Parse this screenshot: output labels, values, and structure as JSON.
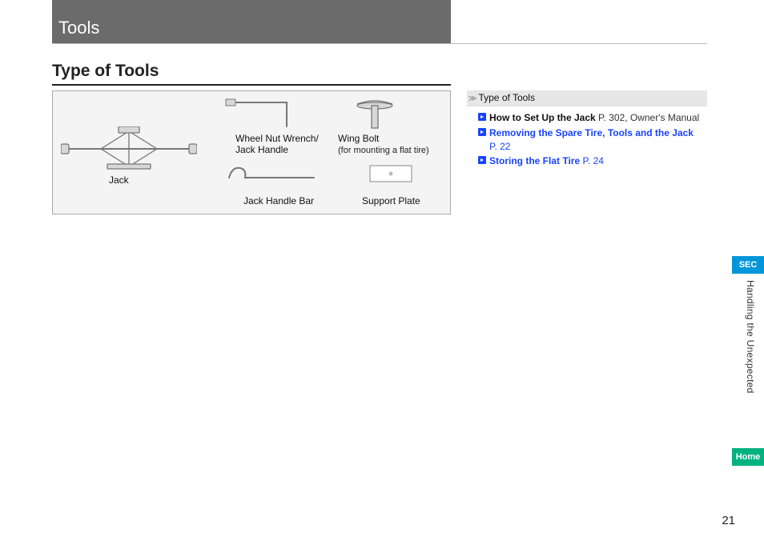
{
  "header": {
    "title": "Tools"
  },
  "section": {
    "title": "Type of Tools"
  },
  "figure": {
    "jack": "Jack",
    "wrench": "Wheel Nut Wrench/\nJack Handle",
    "handle": "Jack Handle Bar",
    "bolt": "Wing Bolt",
    "bolt_sub": "(for mounting a flat tire)",
    "plate": "Support Plate"
  },
  "sidebar": {
    "heading": "Type of Tools",
    "refs": [
      {
        "bold": "How to Set Up the Jack",
        "page": "P. 302",
        "tail": ", Owner's Manual",
        "link": false
      },
      {
        "bold": "Removing the Spare Tire, Tools and the Jack",
        "page": "P. 22",
        "tail": "",
        "link": true
      },
      {
        "bold": "Storing the Flat Tire",
        "page": "P. 24",
        "tail": "",
        "link": true
      }
    ]
  },
  "tabs": {
    "sec": "SEC",
    "home": "Home",
    "chapter": "Handling the Unexpected"
  },
  "page_number": "21"
}
